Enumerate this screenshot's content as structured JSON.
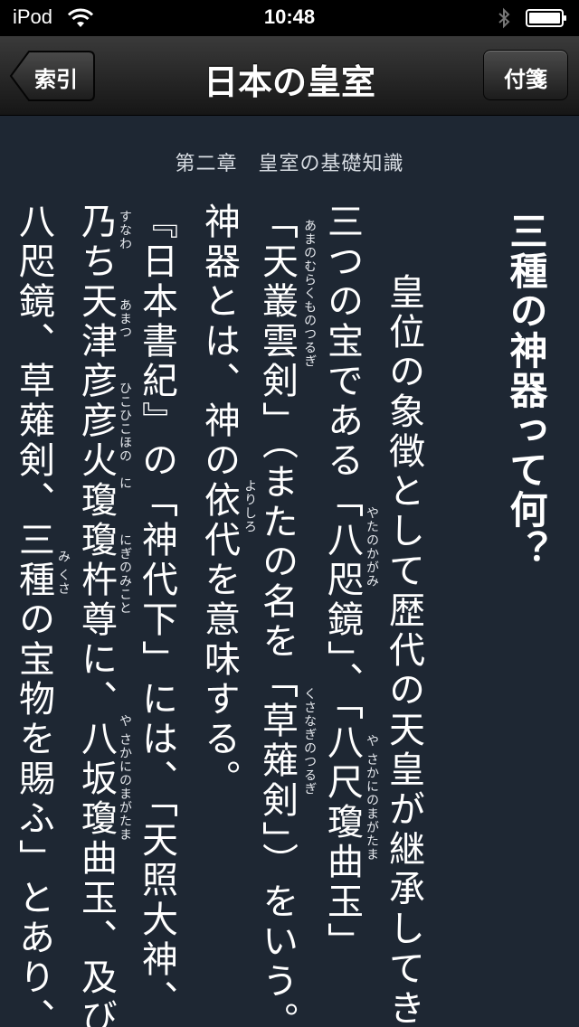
{
  "status_bar": {
    "carrier": "iPod",
    "time": "10:48"
  },
  "nav": {
    "back_label": "索引",
    "title": "日本の皇室",
    "right_label": "付箋"
  },
  "chapter": "第二章　皇室の基礎知識",
  "heading": "三種の神器って何？",
  "columns": [
    "　皇位の象徴として歴代の天皇が継承してきた",
    "三つの宝である「八咫鏡」、「八尺瓊曲玉」",
    "「天叢雲剣」（またの名を「草薙剣」）をいう。",
    "神器とは、神の依代を意味する。",
    "『日本書紀』の「神代下」には、「天照大神、",
    "乃ち天津彦彦火瓊瓊杵尊に、八坂瓊曲玉、及び",
    "八咫鏡、草薙剣、三種の宝物を賜ふ」とあり、"
  ],
  "ruby": {
    "yatanokagami": "やたのかがみ",
    "yasakani_1": "や さかにのまがたま",
    "amenomurakumo": "あまのむらくものつるぎ",
    "kusanagi_1": "くさなぎのつるぎ",
    "yorishiro": "よりしろ",
    "sunawa": "すなわ",
    "amatsu": "あまつ",
    "hikohikohono": "ひこひこほの",
    "ni": "に",
    "niginomikoto": "にぎのみこと",
    "yasakani_2": "や さかにのまがたま",
    "mikusa": "み くさ"
  }
}
